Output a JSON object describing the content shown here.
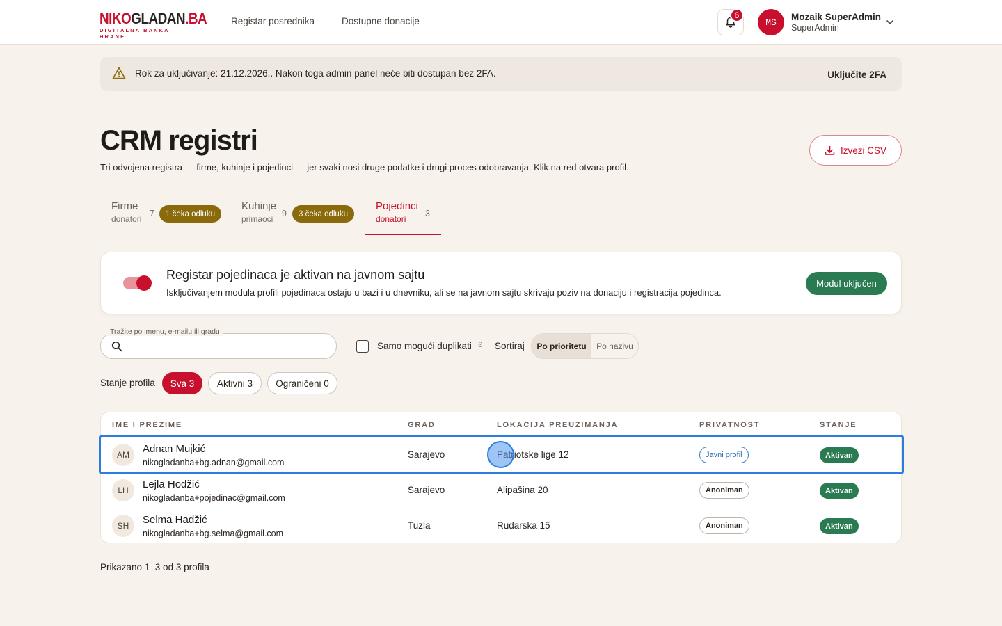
{
  "logo": {
    "brand_red": "NIKO",
    "brand_dark": "GLADAN",
    "brand_suffix": ".BA",
    "tagline": "DIGITALNA BANKA HRANE"
  },
  "nav": {
    "items": [
      {
        "label": "Registar posrednika"
      },
      {
        "label": "Dostupne donacije"
      }
    ]
  },
  "notifications": {
    "count": "6"
  },
  "user": {
    "initials": "MS",
    "name": "Mozaik SuperAdmin",
    "role": "SuperAdmin"
  },
  "alert": {
    "message": "Rok za uključivanje: 21.12.2026.. Nakon toga admin panel neće biti dostupan bez 2FA.",
    "action": "Uključite 2FA"
  },
  "page": {
    "title": "CRM registri",
    "subtitle": "Tri odvojena registra — firme, kuhinje i pojedinci — jer svaki nosi druge podatke i drugi proces odobravanja. Klik na red otvara profil.",
    "export_label": "Izvezi CSV"
  },
  "tabs": [
    {
      "label": "Firme",
      "sub": "donatori",
      "count": "7",
      "pending": "1 čeka odluku"
    },
    {
      "label": "Kuhinje",
      "sub": "primaoci",
      "count": "9",
      "pending": "3 čeka odluku"
    },
    {
      "label": "Pojedinci",
      "sub": "donatori",
      "count": "3"
    }
  ],
  "module": {
    "title": "Registar pojedinaca je aktivan na javnom sajtu",
    "description": "Isključivanjem modula profili pojedinaca ostaju u bazi i u dnevniku, ali se na javnom sajtu skrivaju poziv na donaciju i registracija pojedinca.",
    "button": "Modul uključen",
    "enabled": true
  },
  "filters": {
    "search_label": "Tražite po imenu, e-mailu ili gradu",
    "search_value": "",
    "duplicates_label": "Samo mogući duplikati",
    "duplicates_count": "0",
    "sort_label": "Sortiraj",
    "sort_options": [
      "Po prioritetu",
      "Po nazivu"
    ],
    "state_label": "Stanje profila",
    "state_pills": [
      "Sva 3",
      "Aktivni 3",
      "Ograničeni 0"
    ]
  },
  "table": {
    "headers": [
      "IME I PREZIME",
      "GRAD",
      "LOKACIJA PREUZIMANJA",
      "PRIVATNOST",
      "STANJE"
    ],
    "rows": [
      {
        "initials": "AM",
        "name": "Adnan Mujkić",
        "email": "nikogladanba+bg.adnan@gmail.com",
        "city": "Sarajevo",
        "location": "Patriotske lige 12",
        "privacy": "Javni profil",
        "state": "Aktivan"
      },
      {
        "initials": "LH",
        "name": "Lejla Hodžić",
        "email": "nikogladanba+pojedinac@gmail.com",
        "city": "Sarajevo",
        "location": "Alipašina 20",
        "privacy": "Anoniman",
        "state": "Aktivan"
      },
      {
        "initials": "SH",
        "name": "Selma Hadžić",
        "email": "nikogladanba+bg.selma@gmail.com",
        "city": "Tuzla",
        "location": "Rudarska 15",
        "privacy": "Anoniman",
        "state": "Aktivan"
      }
    ]
  },
  "footer": {
    "summary": "Prikazano 1–3 od 3 profila"
  },
  "colors": {
    "accent": "#c8102e",
    "success": "#2a7a52",
    "pending": "#8a6a0b",
    "background": "#f7f2ec"
  }
}
